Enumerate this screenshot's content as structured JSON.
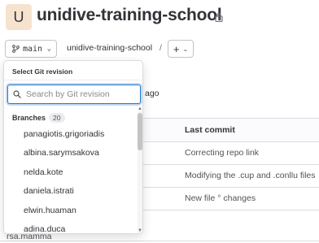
{
  "project": {
    "avatar_letter": "U",
    "title": "unidive-training-school"
  },
  "toolbar": {
    "branch_label": "main",
    "breadcrumb_repo": "unidive-training-school",
    "breadcrumb_sep": "/",
    "add_label": "+"
  },
  "background": {
    "ago_fragment": "ago",
    "last_commit_header": "Last commit",
    "commit_messages": [
      "Correcting repo link",
      "Modifying the .cup and .conllu files",
      "New file ° changes"
    ],
    "bottom_peek": "rsa.mamma"
  },
  "dropdown": {
    "header": "Select Git revision",
    "search_placeholder": "Search by Git revision",
    "section_label": "Branches",
    "branch_count": "20",
    "branches": [
      "panagiotis.grigoriadis",
      "albina.sarymsakova",
      "nelda.kote",
      "daniela.istrati",
      "elwin.huaman",
      "adina.duca"
    ]
  },
  "colors": {
    "accent": "#1f75cb",
    "avatar_bg": "#f6e3cf"
  }
}
